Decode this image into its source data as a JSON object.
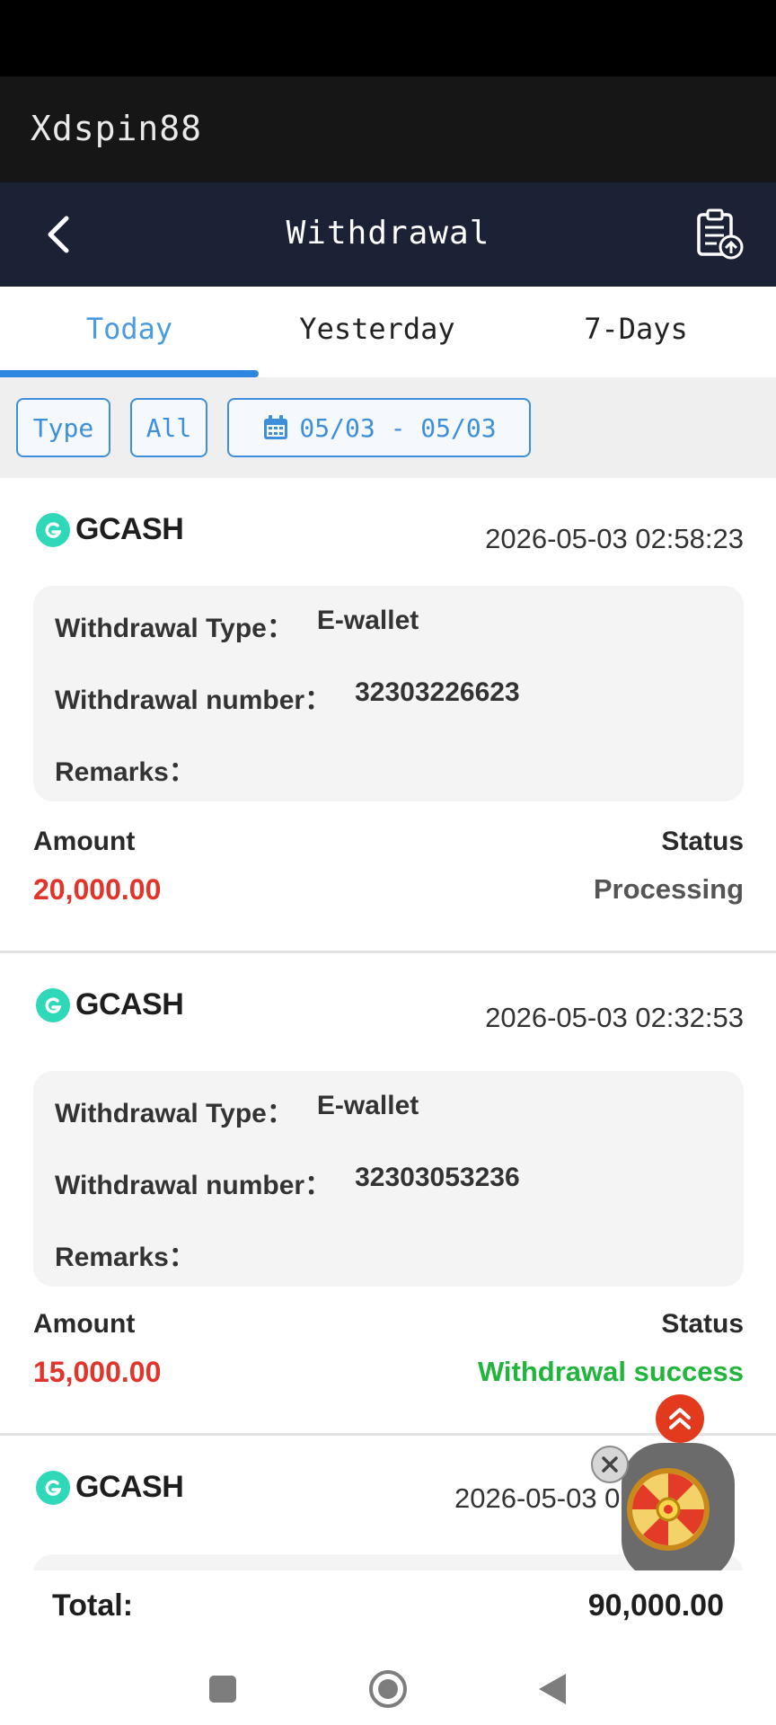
{
  "app": {
    "title": "Xdspin88"
  },
  "nav": {
    "title": "Withdrawal"
  },
  "tabs": [
    {
      "label": "Today"
    },
    {
      "label": "Yesterday"
    },
    {
      "label": "7-Days"
    }
  ],
  "filters": {
    "type": "Type",
    "all": "All",
    "date_range": "05/03 - 05/03"
  },
  "labels": {
    "withdrawal_type": "Withdrawal Type：",
    "withdrawal_number": "Withdrawal number：",
    "remarks": "Remarks：",
    "amount": "Amount",
    "status": "Status"
  },
  "records": [
    {
      "provider": "GCASH",
      "timestamp": "2026-05-03 02:58:23",
      "type": "E-wallet",
      "number": "32303226623",
      "remarks": "",
      "amount": "20,000.00",
      "status": "Processing"
    },
    {
      "provider": "GCASH",
      "timestamp": "2026-05-03 02:32:53",
      "type": "E-wallet",
      "number": "32303053236",
      "remarks": "",
      "amount": "15,000.00",
      "status": "Withdrawal success"
    },
    {
      "provider": "GCASH",
      "timestamp": "2026-05-03 0"
    }
  ],
  "total": {
    "label": "Total:",
    "value": "90,000.00"
  },
  "colors": {
    "accent": "#2f86e0",
    "amount": "#e2342a",
    "success": "#22b53c",
    "processing": "#555555",
    "gcash": "#2fd8b8"
  },
  "icons": [
    "back-arrow-icon",
    "clipboard-upload-icon",
    "calendar-icon",
    "gcash-logo-icon",
    "close-icon",
    "scroll-top-icon",
    "spin-wheel-icon",
    "square-nav-icon",
    "home-nav-icon",
    "back-nav-icon"
  ]
}
